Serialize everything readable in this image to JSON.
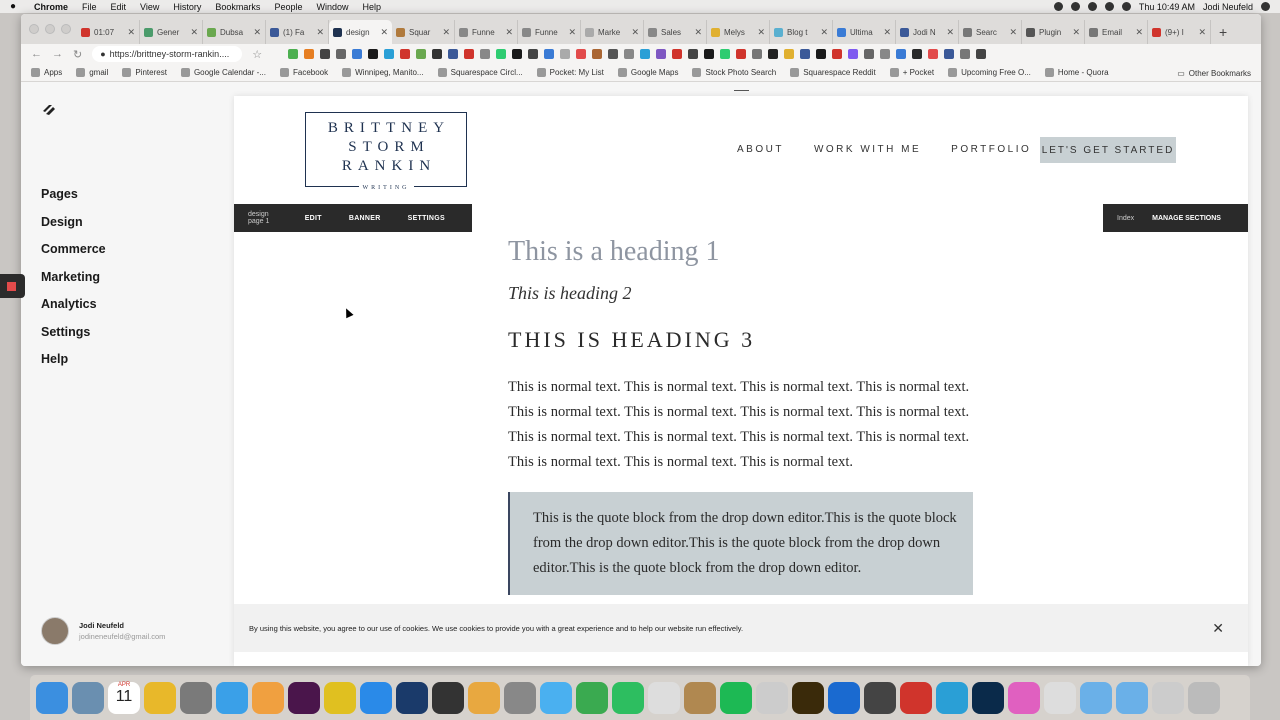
{
  "menubar": {
    "app": "Chrome",
    "menus": [
      "File",
      "Edit",
      "View",
      "History",
      "Bookmarks",
      "People",
      "Window",
      "Help"
    ],
    "clock": "Thu 10:49 AM",
    "user": "Jodi Neufeld"
  },
  "tabs": [
    {
      "label": "01:07",
      "color": "#d0342c"
    },
    {
      "label": "Gener",
      "color": "#4b9b6b"
    },
    {
      "label": "Dubsa",
      "color": "#6aa84f"
    },
    {
      "label": "(1) Fa",
      "color": "#3b5998"
    },
    {
      "label": "design",
      "color": "#1f3250",
      "active": true
    },
    {
      "label": "Squar",
      "color": "#b07a3c"
    },
    {
      "label": "Funne",
      "color": "#888888"
    },
    {
      "label": "Funne",
      "color": "#888888"
    },
    {
      "label": "Marke",
      "color": "#aaaaaa"
    },
    {
      "label": "Sales",
      "color": "#888888"
    },
    {
      "label": "Melys",
      "color": "#e0b030"
    },
    {
      "label": "Blog t",
      "color": "#5ab0d0"
    },
    {
      "label": "Ultima",
      "color": "#3a7bd5"
    },
    {
      "label": "Jodi N",
      "color": "#3b5998"
    },
    {
      "label": "Searc",
      "color": "#777777"
    },
    {
      "label": "Plugin",
      "color": "#555555"
    },
    {
      "label": "Email",
      "color": "#777777"
    },
    {
      "label": "(9+) I",
      "color": "#d0342c"
    }
  ],
  "toolbar": {
    "url": "https://brittney-storm-rankin...."
  },
  "bookmarks": {
    "items": [
      "Apps",
      "gmail",
      "Pinterest",
      "Google Calendar -...",
      "Facebook",
      "Winnipeg, Manito...",
      "Squarespace Circl...",
      "Pocket: My List",
      "Google Maps",
      "Stock Photo Search",
      "Squarespace Reddit",
      "+ Pocket",
      "Upcoming Free O...",
      "Home - Quora"
    ],
    "other": "Other Bookmarks"
  },
  "sidenav": {
    "items": [
      "Pages",
      "Design",
      "Commerce",
      "Marketing",
      "Analytics",
      "Settings",
      "Help"
    ]
  },
  "user": {
    "name": "Jodi Neufeld",
    "email": "jodineneufeld@gmail.com"
  },
  "site": {
    "brand_line1": "BRITTNEY",
    "brand_line2": "STORM",
    "brand_line3": "RANKIN",
    "brand_line4": "WRITING",
    "nav": [
      "ABOUT",
      "WORK WITH ME",
      "PORTFOLIO"
    ],
    "cta": "LET'S GET STARTED"
  },
  "editbar": {
    "page": "design page 1",
    "edit": "EDIT",
    "banner": "BANNER",
    "settings": "SETTINGS",
    "index": "Index",
    "manage": "MANAGE SECTIONS"
  },
  "content": {
    "h1": "This is a heading 1",
    "h2": "This is heading 2",
    "h3": "THIS IS HEADING 3",
    "paragraph": "This is normal text. This is normal text. This is normal text. This is normal text. This is normal text. This is normal text. This is normal text. This is normal text. This is normal text. This is normal text. This is normal text. This is normal text. This is normal text. This is normal text. This is normal text.",
    "quote": "This is the quote block from the drop down editor.This is the quote block from the drop down editor.This is the quote block from the drop down editor.This is the quote block from the drop down editor."
  },
  "cookie": {
    "text": "By using this website, you agree to our use of cookies. We use cookies to provide you with a great experience and to help our website run effectively."
  },
  "dock": {
    "calendar_month": "APR",
    "calendar_day": "11"
  }
}
